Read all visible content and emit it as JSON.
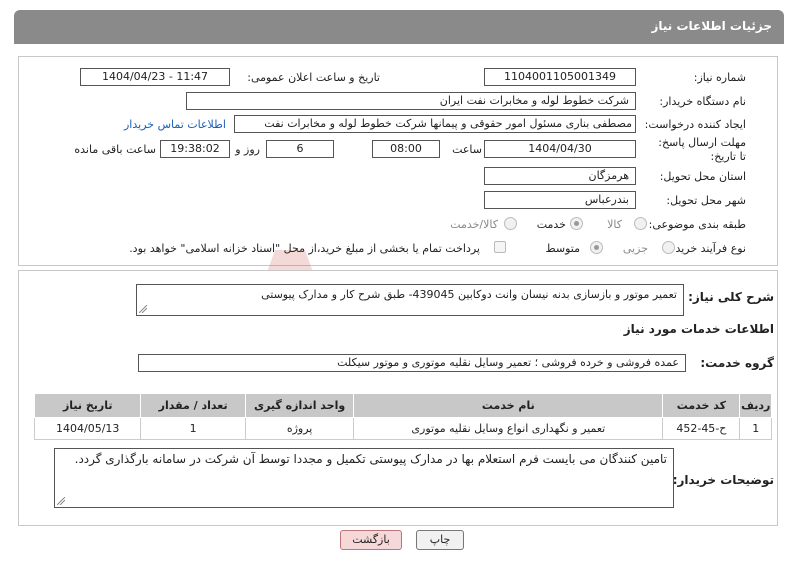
{
  "header": {
    "title": "جزئیات اطلاعات نیاز"
  },
  "fields": {
    "need_number_label": "شماره نیاز:",
    "need_number": "1104001105001349",
    "announce_label": "تاریخ و ساعت اعلان عمومی:",
    "announce_value": "1404/04/23 - 11:47",
    "buyer_org_label": "نام دستگاه خریدار:",
    "buyer_org": "شرکت خطوط لوله و مخابرات نفت ایران",
    "requester_label": "ایجاد کننده درخواست:",
    "requester": "مصطفی بناری مسئول امور حقوقی و پیمانها  شرکت خطوط لوله و مخابرات نفت",
    "buyer_contact_link": "اطلاعات تماس خریدار",
    "deadline_label": "مهلت ارسال پاسخ: تا تاریخ:",
    "deadline_date": "1404/04/30",
    "time_label": "ساعت",
    "deadline_time": "08:00",
    "days_value": "6",
    "days_label": "روز و",
    "remaining_time": "19:38:02",
    "remaining_label": "ساعت باقی مانده",
    "province_label": "استان محل تحویل:",
    "province": "هرمزگان",
    "city_label": "شهر محل تحویل:",
    "city": "بندرعباس",
    "category_label": "طبقه بندی موضوعی:",
    "category_options": [
      "کالا",
      "خدمت",
      "کالا/خدمت"
    ],
    "category_selected": "خدمت",
    "process_label": "نوع فرآیند خرید :",
    "process_options": [
      "جزیی",
      "متوسط"
    ],
    "process_selected": "متوسط",
    "payment_note": "پرداخت تمام یا بخشی از مبلغ خرید،از محل \"اسناد خزانه اسلامی\" خواهد بود."
  },
  "summary": {
    "label": "شرح کلی نیاز:",
    "text": "تعمیر موتور و بازسازی بدنه نیسان وانت دوکابین 439045- طبق شرح کار و مدارک پیوستی"
  },
  "services": {
    "section_title": "اطلاعات خدمات مورد نیاز",
    "group_label": "گروه خدمت:",
    "group_value": "عمده فروشی و خرده فروشی ؛ تعمیر وسایل نقلیه موتوری و موتور سیکلت",
    "columns": [
      "ردیف",
      "کد خدمت",
      "نام خدمت",
      "واحد اندازه گیری",
      "تعداد / مقدار",
      "تاریخ نیاز"
    ],
    "rows": [
      [
        "1",
        "ح-45-452",
        "تعمیر و نگهداری انواع وسایل نقلیه موتوری",
        "پروژه",
        "1",
        "1404/05/13"
      ]
    ]
  },
  "buyer_notes": {
    "label": "توضیحات خریدار:",
    "text": "تامین کنندگان می بایست فرم استعلام بها در مدارک پیوستی تکمیل و مجددا توسط آن شرکت در سامانه بارگذاری گردد."
  },
  "buttons": {
    "print": "چاپ",
    "back": "بازگشت"
  },
  "colors": {
    "header_bg": "#8a8a8a",
    "link": "#1a5fb4",
    "back_button": "#f7d8d8",
    "watermark": "#c0392b"
  }
}
